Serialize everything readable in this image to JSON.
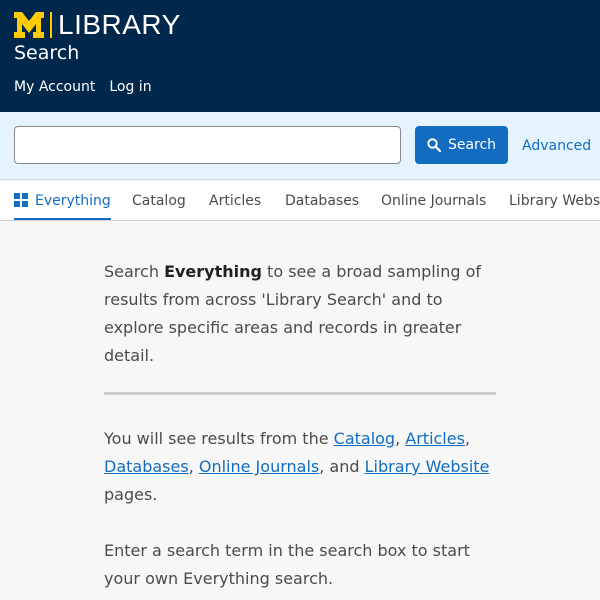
{
  "header": {
    "logo_text": "LIBRARY",
    "app_title": "Search",
    "nav": [
      "My Account",
      "Log in"
    ]
  },
  "search": {
    "input_value": "",
    "placeholder": "",
    "button_label": "Search",
    "advanced_label": "Advanced"
  },
  "tabs": [
    "Everything",
    "Catalog",
    "Articles",
    "Databases",
    "Online Journals",
    "Library Website"
  ],
  "intro": {
    "pre": "Search ",
    "bold": "Everything",
    "post": " to see a broad sampling of results from across 'Library Search' and to explore specific areas and records in greater detail."
  },
  "results_info": {
    "pre": "You will see results from the ",
    "links": [
      "Catalog",
      "Articles",
      "Databases",
      "Online Journals",
      "Library Website"
    ],
    "sep1": ", ",
    "sep2": ", ",
    "sep3": ", ",
    "sep4": ", and ",
    "post": " pages."
  },
  "hint": "Enter a search term in the search box to start your own Everything search.",
  "colors": {
    "header_bg": "#00274c",
    "maize": "#ffcb05",
    "accent": "#126dc1",
    "search_bar_bg": "#e5f3ff"
  }
}
